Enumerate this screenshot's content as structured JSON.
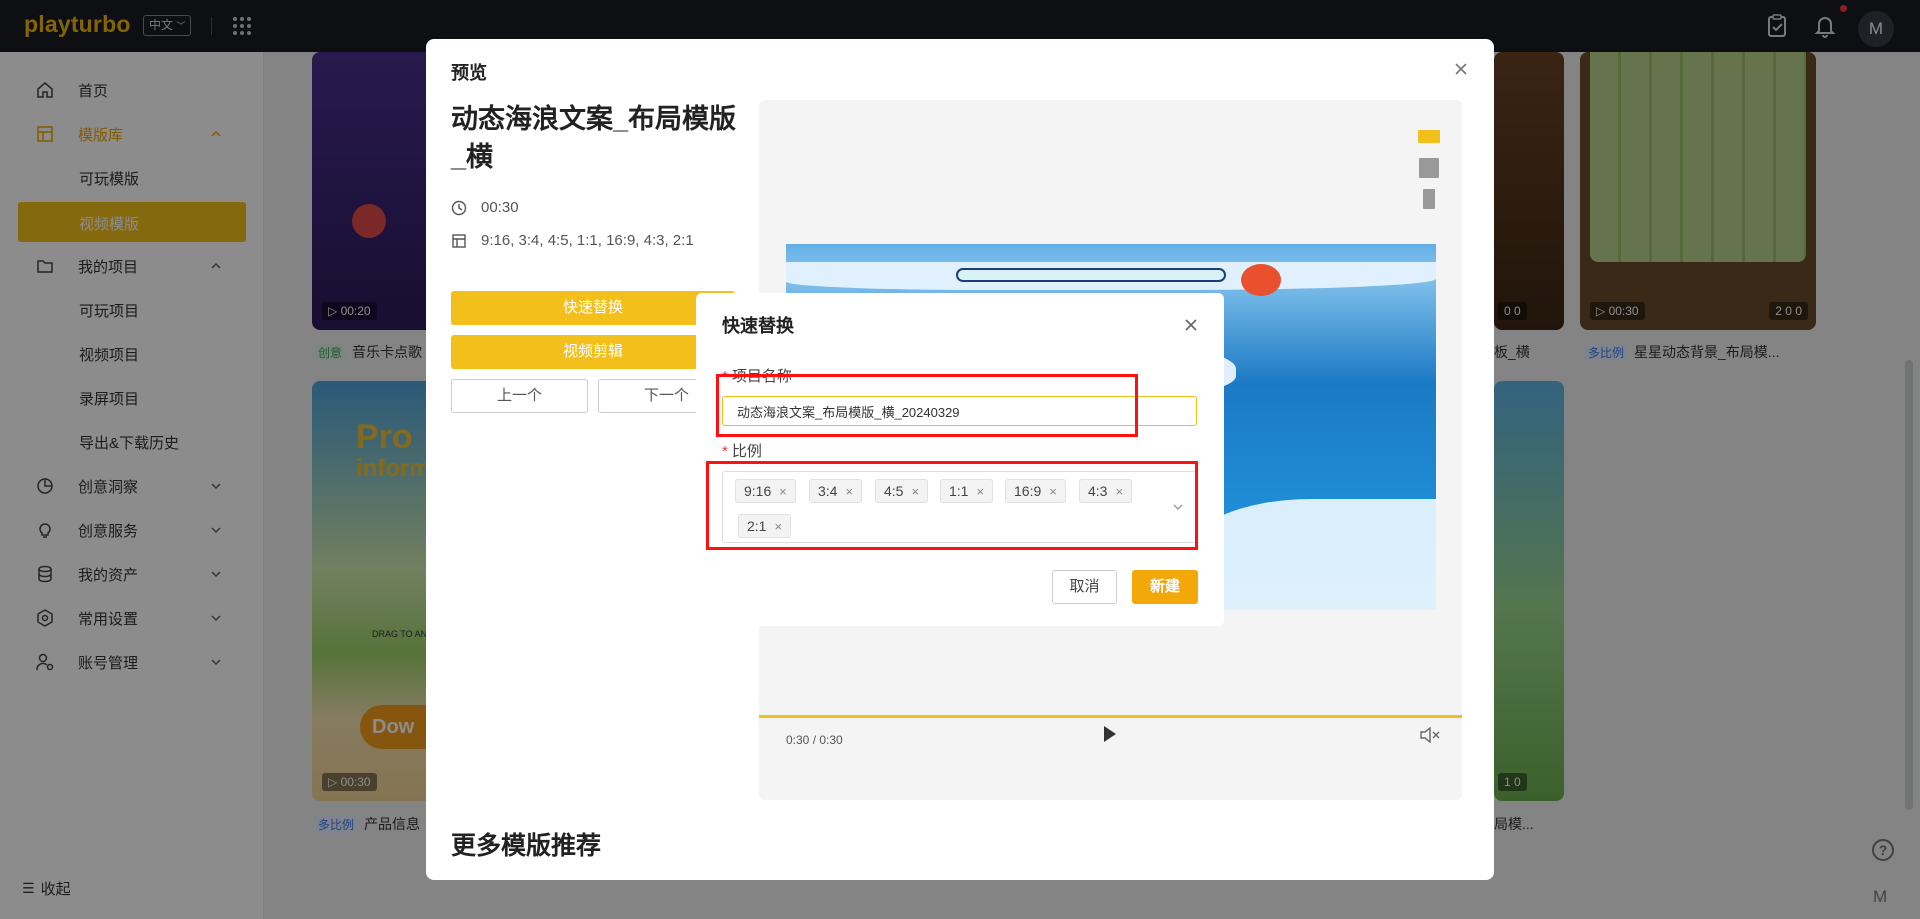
{
  "topbar": {
    "logo": "playturbo",
    "lang": "中文"
  },
  "sidebar": {
    "home": "首页",
    "template_lib": "模版库",
    "playable_template": "可玩模版",
    "video_template": "视频模版",
    "my_projects": "我的项目",
    "playable_project": "可玩项目",
    "video_project": "视频项目",
    "screen_record_project": "录屏项目",
    "export_history": "导出&下载历史",
    "creative_insight": "创意洞察",
    "creative_service": "创意服务",
    "my_assets": "我的资产",
    "common_settings": "常用设置",
    "account_management": "账号管理",
    "collapse": "收起"
  },
  "cards": {
    "c1_time": "00:20",
    "c1_tag": "创意",
    "c1_caption": "音乐卡点歌",
    "c2_stats": "0  0",
    "c2_caption": "板_横",
    "c3_time": "00:30",
    "c3_stats": "2  0  0",
    "c3_tag": "多比例",
    "c3_caption": "星星动态背景_布局模...",
    "c4_time": "00:30",
    "c4_tag": "多比例",
    "c4_caption": "产品信息",
    "c4_banner1": "Pro",
    "c4_banner2": "inform",
    "c4_drag": "DRAG TO AN",
    "c4_down": "Dow",
    "c5_stats": "1  0",
    "c5_caption": "局模..."
  },
  "preview": {
    "heading": "预览",
    "title": "动态海浪文案_布局模版_横",
    "duration": "00:30",
    "ratios": "9:16, 3:4, 4:5, 1:1, 16:9, 4:3, 2:1",
    "quick_replace_btn": "快速替换",
    "video_edit_btn": "视频剪辑",
    "prev_btn": "上一个",
    "next_btn": "下一个",
    "player_time": "0:30 / 0:30",
    "more_title": "更多模版推荐"
  },
  "quick_replace": {
    "title": "快速替换",
    "name_label": "项目名称",
    "name_value": "动态海浪文案_布局模版_横_20240329",
    "ratio_label": "比例",
    "chips": [
      "9:16",
      "3:4",
      "4:5",
      "1:1",
      "16:9",
      "4:3",
      "2:1"
    ],
    "cancel": "取消",
    "create": "新建"
  },
  "colors": {
    "brand": "#f3bf1a",
    "primary_button": "#f3a80a",
    "highlight": "#ff1111"
  }
}
